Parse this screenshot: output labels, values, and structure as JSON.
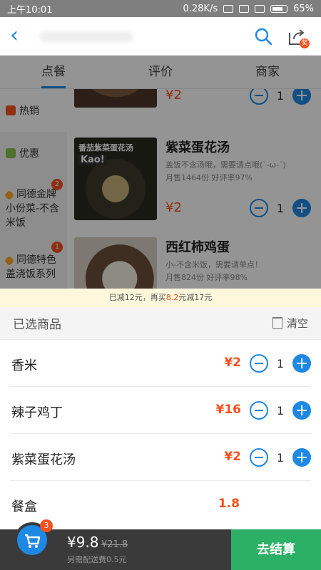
{
  "status": {
    "time": "上午10:01",
    "speed": "0.28K/s",
    "battery": "65%"
  },
  "nav": {
    "back_icon": "back-arrow-icon",
    "search_icon": "search-icon",
    "share_icon": "share-icon",
    "reward_badge": "奖"
  },
  "tabs": [
    {
      "label": "点餐"
    },
    {
      "label": "评价"
    },
    {
      "label": "商家"
    }
  ],
  "sidebar": {
    "items": [
      {
        "label": "热销",
        "icon": "fire-icon",
        "color": "#f4511e"
      },
      {
        "label": "优惠",
        "icon": "coupon-icon",
        "color": "#8bc34a"
      },
      {
        "label": "同德金牌小份菜-不含米饭",
        "badge": "2",
        "icon": "diamond-icon",
        "color": "#f9a825"
      },
      {
        "label": "同德特色盖浇饭系列",
        "badge": "1",
        "icon": "diamond-icon",
        "color": "#f9a825"
      }
    ]
  },
  "menu": {
    "top_item": {
      "price": "¥2",
      "qty": "1"
    },
    "items": [
      {
        "name": "紫菜蛋花汤",
        "desc": "盖饭不含汤哦，需要请点哦(`-ω-´)",
        "sales": "月售1464份",
        "rating": "好评率97%",
        "price": "¥2",
        "qty": "1",
        "thumb_text1": "番茄紫菜蛋花汤",
        "thumb_text2": "Kao!"
      },
      {
        "name": "西红柿鸡蛋",
        "desc": "小-不含米饭，需要请单点！",
        "sales": "月售824份",
        "rating": "好评率98%"
      }
    ]
  },
  "promo": {
    "prefix": "已减12元，再买",
    "amount": "8.2",
    "suffix": "元减17元"
  },
  "cart": {
    "title": "已选商品",
    "clear_label": "清空",
    "rows": [
      {
        "name": "香米",
        "price": "¥2",
        "qty": "1"
      },
      {
        "name": "辣子鸡丁",
        "price": "¥16",
        "qty": "1"
      },
      {
        "name": "紫菜蛋花汤",
        "price": "¥2",
        "qty": "1"
      },
      {
        "name": "餐盒",
        "price": "1.8"
      }
    ]
  },
  "bottom": {
    "cart_count": "3",
    "total": "¥9.8",
    "original": "¥21.8",
    "delivery": "另需配送费0.5元",
    "checkout": "去结算"
  }
}
